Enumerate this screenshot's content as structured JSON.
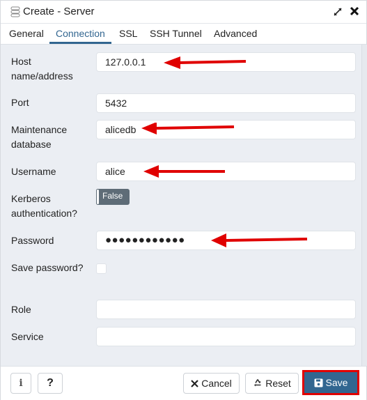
{
  "dialog": {
    "title": "Create - Server",
    "title_icon": "server-icon",
    "controls": [
      "expand-icon",
      "close-icon"
    ]
  },
  "tabs": [
    {
      "label": "General",
      "active": false
    },
    {
      "label": "Connection",
      "active": true
    },
    {
      "label": "SSL",
      "active": false
    },
    {
      "label": "SSH Tunnel",
      "active": false
    },
    {
      "label": "Advanced",
      "active": false
    }
  ],
  "form": {
    "host": {
      "label": "Host name/address",
      "value": "127.0.0.1"
    },
    "port": {
      "label": "Port",
      "value": "5432"
    },
    "maintenance_db": {
      "label": "Maintenance database",
      "value": "alicedb"
    },
    "username": {
      "label": "Username",
      "value": "alice"
    },
    "kerberos": {
      "label": "Kerberos authentication?",
      "value": "False"
    },
    "password": {
      "label": "Password",
      "value": "●●●●●●●●●●●●"
    },
    "save_password": {
      "label": "Save password?",
      "checked": false
    },
    "role": {
      "label": "Role",
      "value": ""
    },
    "service": {
      "label": "Service",
      "value": ""
    }
  },
  "annotations": {
    "arrow_color": "#e00000",
    "arrows_point_to": [
      "host",
      "maintenance_db",
      "username",
      "password"
    ],
    "highlighted_button": "save"
  },
  "footer": {
    "info_label": "i",
    "help_label": "?",
    "cancel_label": "Cancel",
    "reset_label": "Reset",
    "save_label": "Save"
  },
  "colors": {
    "accent": "#326690",
    "content_bg": "#ebeef3",
    "toggle_off": "#5e6c77"
  }
}
